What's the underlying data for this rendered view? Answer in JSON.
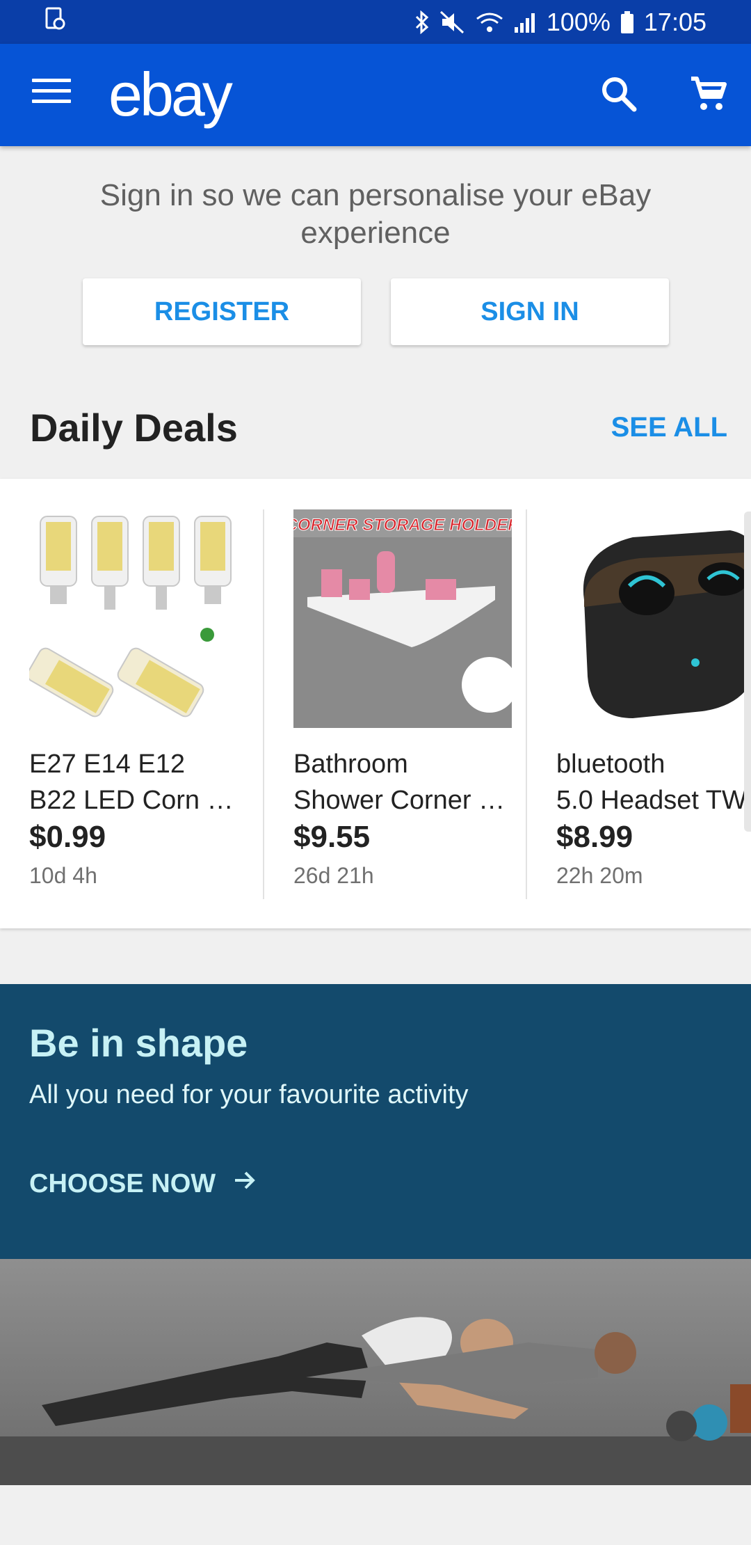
{
  "status_bar": {
    "battery": "100%",
    "time": "17:05",
    "icons": [
      "screen-record-icon",
      "bluetooth-icon",
      "mute-icon",
      "wifi-icon",
      "signal-icon",
      "battery-icon"
    ]
  },
  "app_bar": {
    "logo": "ebay",
    "icons": [
      "menu-icon",
      "search-icon",
      "cart-icon"
    ],
    "color": "#0654d6"
  },
  "signin": {
    "message": "Sign in so we can personalise your eBay experience",
    "register_label": "REGISTER",
    "signin_label": "SIGN IN"
  },
  "deals": {
    "title": "Daily Deals",
    "see_all_label": "SEE ALL",
    "items": [
      {
        "title_line1": "E27 E14 E12",
        "title_line2": "B22 LED Corn B…",
        "price": "$0.99",
        "time_left": "10d 4h"
      },
      {
        "title_line1": "Bathroom",
        "title_line2": "Shower Corner …",
        "price": "$9.55",
        "time_left": "26d 21h",
        "image_caption": "CORNER STORAGE HOLDER"
      },
      {
        "title_line1": "bluetooth",
        "title_line2": "5.0 Headset TW",
        "price": "$8.99",
        "time_left": "22h 20m"
      }
    ]
  },
  "banner": {
    "title": "Be in shape",
    "subtitle": "All you need for your favourite activity",
    "cta_label": "CHOOSE NOW",
    "background": "#134a6c"
  }
}
